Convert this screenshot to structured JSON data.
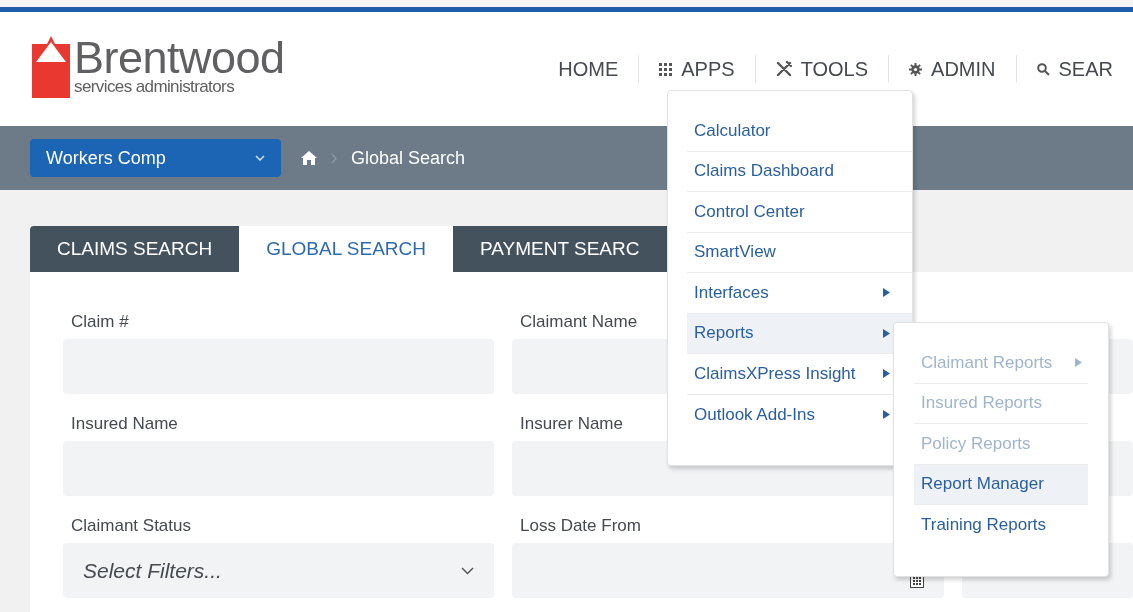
{
  "top_nav": {
    "logo": {
      "name": "Brentwood",
      "tagline": "services administrators"
    },
    "items": [
      {
        "label": "HOME"
      },
      {
        "label": "APPS"
      },
      {
        "label": "TOOLS"
      },
      {
        "label": "ADMIN"
      },
      {
        "label": "SEAR"
      }
    ]
  },
  "breadcrumb_bar": {
    "line_of_business": "Workers Comp",
    "crumbs": [
      "Global Search"
    ]
  },
  "tabs": [
    {
      "label": "CLAIMS SEARCH",
      "selected": false
    },
    {
      "label": "GLOBAL SEARCH",
      "selected": true
    },
    {
      "label": "PAYMENT SEARC",
      "selected": false
    }
  ],
  "form": {
    "rows": [
      [
        {
          "label": "Claim #",
          "kind": "text"
        },
        {
          "label": "Claimant Name",
          "kind": "text"
        },
        {
          "kind": "text"
        }
      ],
      [
        {
          "label": "Insured Name",
          "kind": "text"
        },
        {
          "label": "Insurer Name",
          "kind": "text"
        },
        {
          "kind": "text"
        }
      ],
      [
        {
          "label": "Claimant Status",
          "kind": "select",
          "placeholder": "Select Filters..."
        },
        {
          "label": "Loss Date From",
          "kind": "date"
        },
        {
          "kind": "date"
        }
      ]
    ]
  },
  "apps_menu": {
    "items": [
      {
        "label": "Calculator",
        "submenu": false,
        "selected": false
      },
      {
        "label": "Claims Dashboard",
        "submenu": false,
        "selected": false
      },
      {
        "label": "Control Center",
        "submenu": false,
        "selected": false
      },
      {
        "label": "SmartView",
        "submenu": false,
        "selected": false
      },
      {
        "label": "Interfaces",
        "submenu": true,
        "selected": false
      },
      {
        "label": "Reports",
        "submenu": true,
        "selected": true
      },
      {
        "label": "ClaimsXPress Insight",
        "submenu": true,
        "selected": false
      },
      {
        "label": "Outlook Add-Ins",
        "submenu": true,
        "selected": false
      }
    ]
  },
  "reports_submenu": {
    "items": [
      {
        "label": "Claimant Reports",
        "submenu": true,
        "selected": false,
        "disabled": true
      },
      {
        "label": "Insured Reports",
        "submenu": false,
        "selected": false,
        "disabled": true
      },
      {
        "label": "Policy Reports",
        "submenu": false,
        "selected": false,
        "disabled": true
      },
      {
        "label": "Report Manager",
        "submenu": false,
        "selected": true,
        "disabled": false
      },
      {
        "label": "Training Reports",
        "submenu": false,
        "selected": false,
        "disabled": false
      }
    ]
  }
}
